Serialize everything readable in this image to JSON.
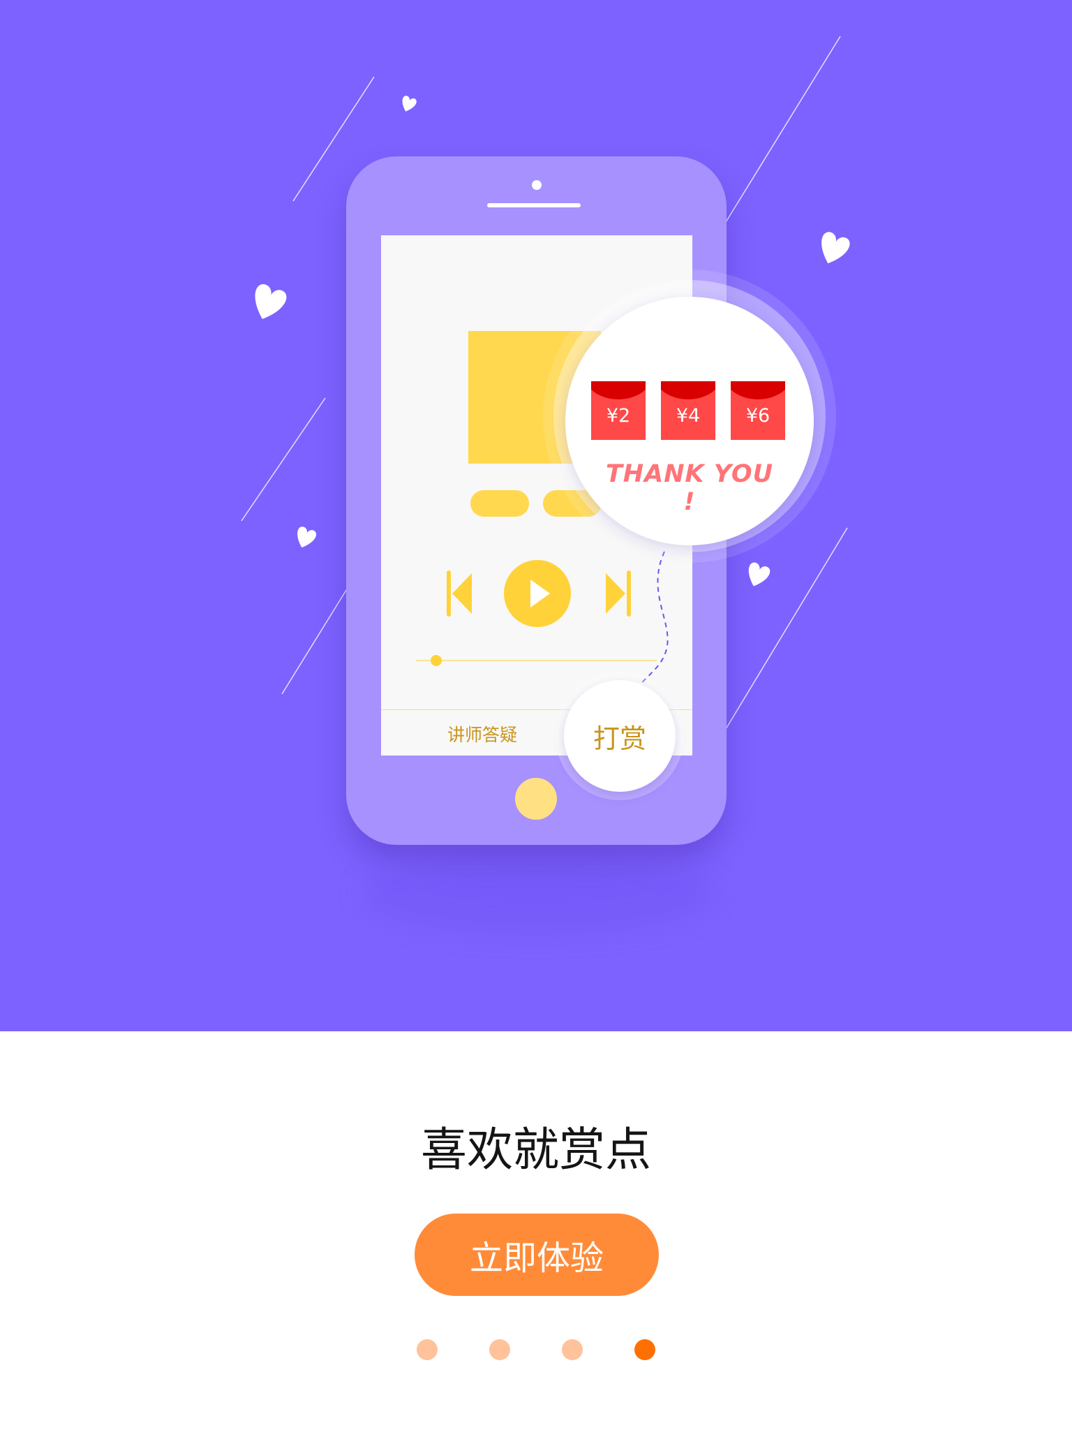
{
  "colors": {
    "hero_background": "#7D62FF",
    "phone_body": "#A791FF",
    "accent_yellow": "#FFD84F",
    "cta_orange": "#FF8B38",
    "indicator_active": "#FF7000",
    "indicator_inactive": "#FFC29A",
    "envelope_red": "#FF4848"
  },
  "phone": {
    "player_controls": [
      "previous-icon",
      "play-icon",
      "next-icon"
    ],
    "tab_label": "讲师答疑"
  },
  "reward_popup": {
    "amounts": [
      "¥2",
      "¥4",
      "¥6"
    ],
    "thanks_text": "THANK YOU !"
  },
  "reward_button_label": "打赏",
  "headline": "喜欢就赏点",
  "cta_label": "立即体验",
  "page_indicator": {
    "count": 4,
    "active_index": 3
  }
}
